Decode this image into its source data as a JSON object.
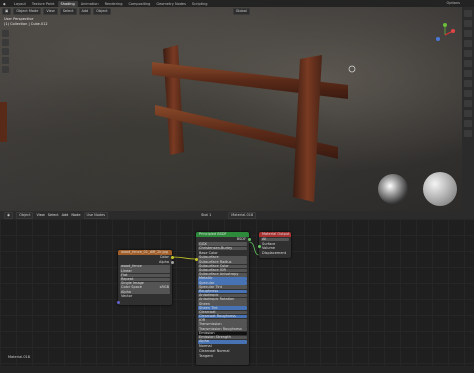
{
  "topbar": {
    "tabs": [
      {
        "label": "Layout"
      },
      {
        "label": "Texture Paint"
      },
      {
        "label": "Shading"
      },
      {
        "label": "Animation"
      },
      {
        "label": "Rendering"
      },
      {
        "label": "Compositing"
      },
      {
        "label": "Geometry Nodes"
      },
      {
        "label": "Scripting"
      }
    ],
    "active_tab": "Shading",
    "view_layer": "Options"
  },
  "viewport": {
    "mode": "Object Mode",
    "menus": [
      "View",
      "Select",
      "Add",
      "Object"
    ],
    "global": "Global",
    "info_line1": "User Perspective",
    "info_line2": "(1) Collection | Cube.012"
  },
  "node_editor": {
    "header_items": [
      "Object",
      "View",
      "Select",
      "Add",
      "Node"
    ],
    "use_nodes": "Use Nodes",
    "slot": "Slot 1",
    "material": "Material.018",
    "material_label": "Material.018"
  },
  "nodes": {
    "image": {
      "title": "wood_fence_01_diff_2k.jpg",
      "outputs": [
        "Color",
        "Alpha"
      ],
      "image_name": "wood_fence",
      "rows": [
        "Linear",
        "Flat",
        "Repeat",
        "Single Image",
        "Color Space",
        "Alpha",
        "Vector"
      ],
      "color_space": "sRGB"
    },
    "bsdf": {
      "title": "Principled BSDF",
      "output": "BSDF",
      "rows": [
        "GGX",
        "Christensen-Burley",
        "Base Color",
        "Subsurface",
        "Subsurface Radius",
        "Subsurface Color",
        "Subsurface IOR",
        "Subsurface Anisotropy",
        "Metallic",
        "Specular",
        "Specular Tint",
        "Roughness",
        "Anisotropic",
        "Anisotropic Rotation",
        "Sheen",
        "Sheen Tint",
        "Clearcoat",
        "Clearcoat Roughness",
        "IOR",
        "Transmission",
        "Transmission Roughness",
        "Emission",
        "Emission Strength",
        "Alpha",
        "Normal",
        "Clearcoat Normal",
        "Tangent"
      ]
    },
    "output": {
      "title": "Material Output",
      "target": "All",
      "inputs": [
        "Surface",
        "Volume",
        "Displacement"
      ]
    }
  },
  "colors": {
    "image_header": "#a35f2a",
    "bsdf_header": "#2d8a3a",
    "output_header": "#a83232",
    "socket_yellow": "#c7c729",
    "socket_green": "#63c763",
    "socket_purple": "#6363c7",
    "socket_gray": "#a1a1a1"
  }
}
